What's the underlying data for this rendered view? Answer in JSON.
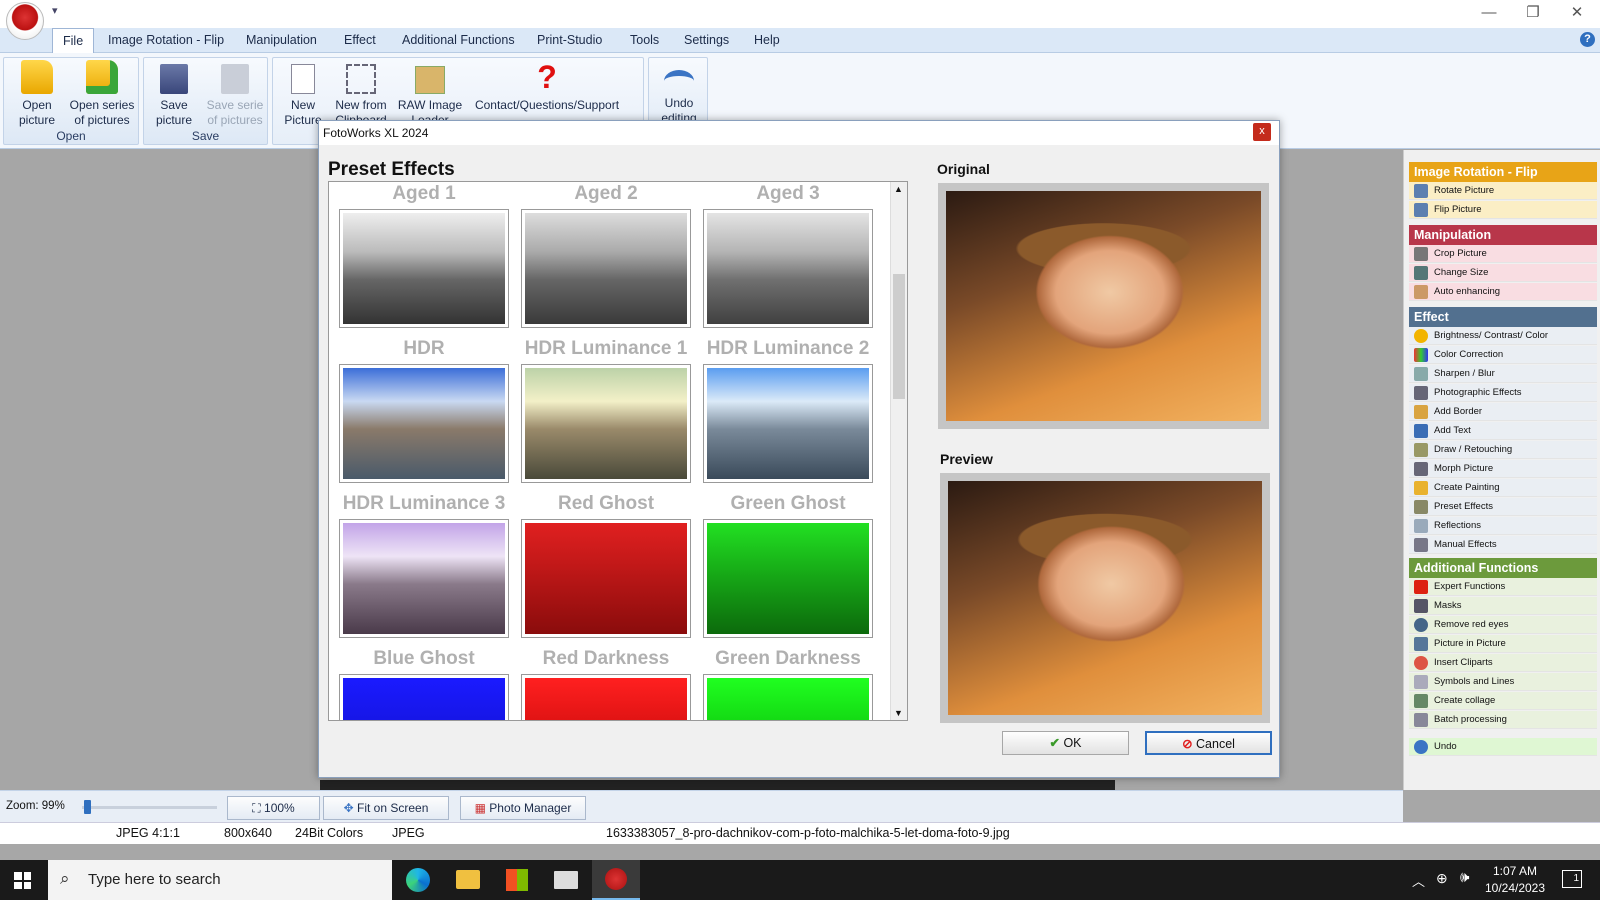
{
  "window": {
    "minimize": "—",
    "restore": "❐",
    "close": "✕",
    "help_icon": "?"
  },
  "menu": [
    "File",
    "Image Rotation - Flip",
    "Manipulation",
    "Effect",
    "Additional Functions",
    "Print-Studio",
    "Tools",
    "Settings",
    "Help"
  ],
  "ribbon": {
    "open_group": "Open",
    "save_group": "Save",
    "open_picture": "Open picture",
    "open_series": "Open series of pictures",
    "save_picture": "Save picture",
    "save_serie": "Save serie of pictures",
    "new_picture": "New Picture",
    "new_from_clipboard": "New from Clipboard",
    "raw_loader": "RAW Image Loader",
    "contact": "Contact/Questions/Support",
    "undo": "Undo editing"
  },
  "dialog": {
    "title": "FotoWorks XL 2024",
    "close": "x",
    "preset_heading": "Preset Effects",
    "original_label": "Original",
    "preview_label": "Preview",
    "ok": "OK",
    "cancel": "Cancel",
    "effects": [
      "Aged 1",
      "Aged 2",
      "Aged 3",
      "HDR",
      "HDR Luminance 1",
      "HDR Luminance 2",
      "HDR Luminance 3",
      "Red Ghost",
      "Green Ghost",
      "Blue Ghost",
      "Red Darkness",
      "Green Darkness"
    ]
  },
  "sidebar": {
    "sections": [
      {
        "title": "Image Rotation - Flip",
        "color": "#e8a417",
        "bg": "#fbeec5",
        "items": [
          "Rotate Picture",
          "Flip Picture"
        ]
      },
      {
        "title": "Manipulation",
        "color": "#b8364a",
        "bg": "#f9dde2",
        "items": [
          "Crop Picture",
          "Change Size",
          "Auto enhancing"
        ]
      },
      {
        "title": "Effect",
        "color": "#52708f",
        "bg": "#eaeef3",
        "items": [
          "Brightness/ Contrast/ Color",
          "Color Correction",
          "Sharpen / Blur",
          "Photographic Effects",
          "Add Border",
          "Add Text",
          "Draw / Retouching",
          "Morph Picture",
          "Create Painting",
          "Preset Effects",
          "Reflections",
          "Manual Effects"
        ]
      },
      {
        "title": "Additional Functions",
        "color": "#6c9a3c",
        "bg": "#e9f1de",
        "items": [
          "Expert Functions",
          "Masks",
          "Remove red eyes",
          "Picture in Picture",
          "Insert Cliparts",
          "Symbols and Lines",
          "Create collage",
          "Batch processing"
        ]
      }
    ],
    "undo": "Undo"
  },
  "zoom": {
    "label": "Zoom: 99%",
    "btn_100": "100%",
    "fit": "Fit on Screen",
    "photo_manager": "Photo Manager"
  },
  "status": {
    "format": "JPEG  4:1:1",
    "size": "800x640",
    "colors": "24Bit Colors",
    "type": "JPEG",
    "filename": "1633383057_8-pro-dachnikov-com-p-foto-malchika-5-let-doma-foto-9.jpg"
  },
  "taskbar": {
    "search_placeholder": "Type here to search",
    "time": "1:07 AM",
    "date": "10/24/2023",
    "notif_count": "1"
  }
}
